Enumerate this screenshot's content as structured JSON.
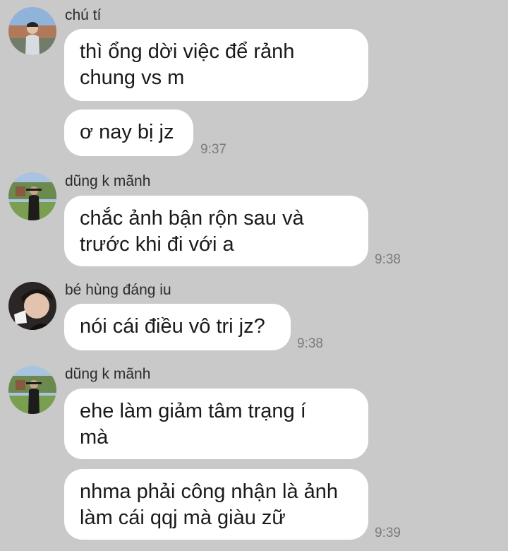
{
  "chat": {
    "groups": [
      {
        "sender": "chú tí",
        "avatar": "avatar-chu-ti",
        "messages": [
          {
            "lines": [
              "thì ổng dời việc để rảnh",
              "chung vs m"
            ],
            "time": ""
          },
          {
            "lines": [
              "ơ nay bị jz"
            ],
            "time": "9:37"
          }
        ]
      },
      {
        "sender": "dũng k mãnh",
        "avatar": "avatar-dung-k-manh",
        "messages": [
          {
            "lines": [
              "chắc ảnh bận rộn sau và",
              "trước khi đi với a"
            ],
            "time": "9:38"
          }
        ]
      },
      {
        "sender": "bé hùng đáng iu",
        "avatar": "avatar-be-hung",
        "messages": [
          {
            "lines": [
              "nói cái điều vô tri jz?"
            ],
            "time": "9:38"
          }
        ]
      },
      {
        "sender": "dũng k mãnh",
        "avatar": "avatar-dung-k-manh",
        "messages": [
          {
            "lines": [
              "ehe làm giảm tâm trạng í",
              "mà"
            ],
            "time": ""
          },
          {
            "lines": [
              "nhma phải công nhận là ảnh",
              "làm cái qqj mà giàu zữ"
            ],
            "time": "9:39"
          }
        ]
      }
    ]
  },
  "colors": {
    "background": "#c9c9c9",
    "bubble": "#ffffff",
    "time_text": "#7b7b7b"
  }
}
